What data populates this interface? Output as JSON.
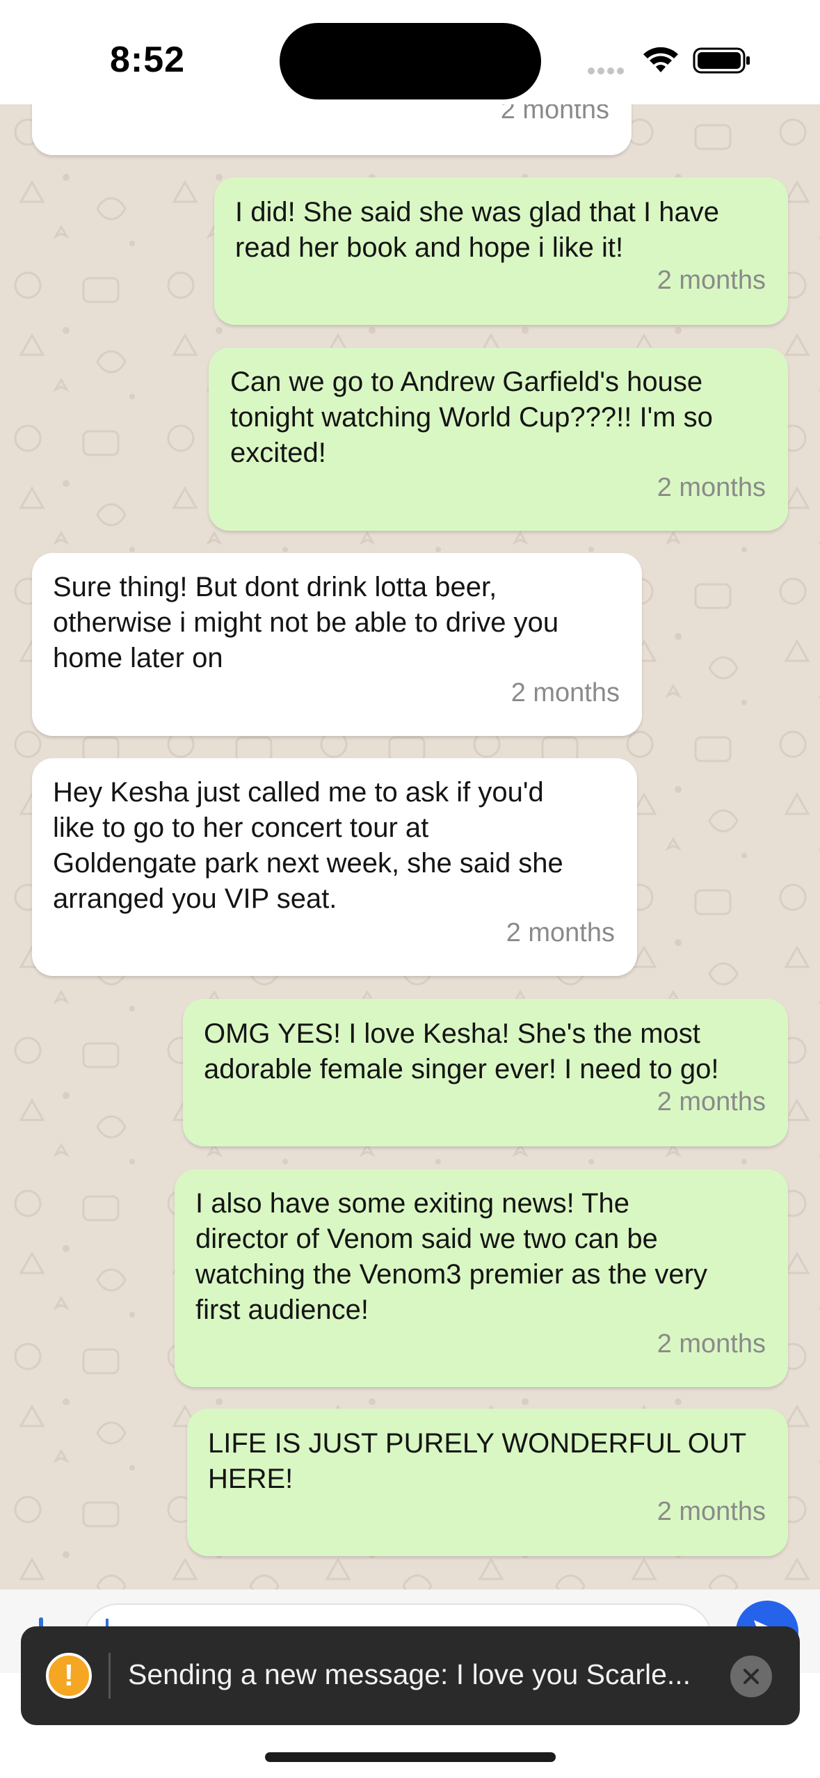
{
  "status_bar": {
    "time": "8:52"
  },
  "messages": [
    {
      "direction": "incoming",
      "text": "",
      "time": "2 months"
    },
    {
      "direction": "outgoing",
      "text": "I did! She said she was glad that I have\nread her book and hope i like it!",
      "time": "2 months"
    },
    {
      "direction": "outgoing",
      "text": "Can we go to Andrew Garfield's house\ntonight watching World Cup???!! I'm so\nexcited!",
      "time": "2 months"
    },
    {
      "direction": "incoming",
      "text": "Sure thing! But dont drink lotta beer,\notherwise i might not be able to drive you\nhome later on",
      "time": "2 months"
    },
    {
      "direction": "incoming",
      "text": "Hey Kesha just called me to ask if you'd\nlike to go to her concert tour at\nGoldengate park next week, she said she\narranged you VIP seat.",
      "time": "2 months"
    },
    {
      "direction": "outgoing",
      "text": "OMG YES! I love Kesha! She's the most\nadorable female singer ever! I need to go!",
      "time": "2 months"
    },
    {
      "direction": "outgoing",
      "text": "I also have some exiting news! The\ndirector of Venom said we two can be\nwatching the Venom3 premier as the very\nfirst audience!",
      "time": "2 months"
    },
    {
      "direction": "outgoing",
      "text": "LIFE IS JUST PURELY WONDERFUL OUT\nHERE!",
      "time": "2 months"
    }
  ],
  "composer": {
    "value": "",
    "send_icon": "send-icon"
  },
  "toast": {
    "icon": "warning-icon",
    "text": "Sending a new message: I love you Scarle...",
    "close_icon": "close-icon"
  },
  "colors": {
    "chat_background": "#e7ded4",
    "incoming_bubble": "#ffffff",
    "outgoing_bubble": "#d9f7c3",
    "timestamp": "#8a8a8a",
    "toast_background": "#2a2a2a",
    "warning": "#f5a623",
    "send_button": "#2563eb"
  }
}
